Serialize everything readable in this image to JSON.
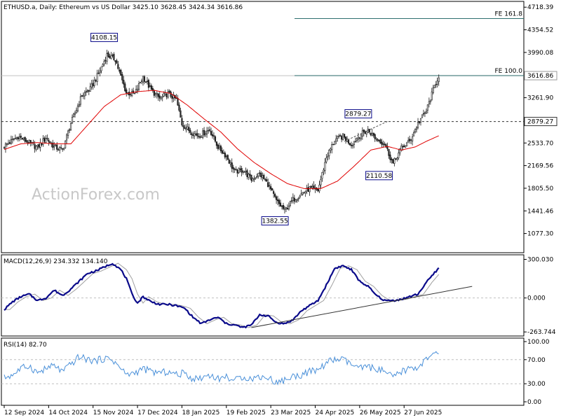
{
  "chart_data": [
    {
      "type": "candlestick",
      "panel": "price",
      "header": "ETHUSD.a, Daily:  Ethereum vs US Dollar  3425.10 3628.45 3424.34 3616.86",
      "ylim": [
        780,
        4800
      ],
      "y_ticks": [
        "4718.39",
        "4354.52",
        "3990.08",
        "3626.06",
        "3261.90",
        "2897.74",
        "2533.70",
        "2169.56",
        "1805.50",
        "1441.46",
        "1077.30"
      ],
      "current_price": "3616.86",
      "current_price_value": 3616.86,
      "level_label": "2879.27",
      "level_value": 2879.27,
      "fib_lines": [
        {
          "label": "FE 161.8",
          "value": 4536
        },
        {
          "label": "FE 100.0",
          "value": 3617
        }
      ],
      "price_labels": [
        {
          "text": "4108.15",
          "value": 4108.15
        },
        {
          "text": "2879.27",
          "value": 2879.27
        },
        {
          "text": "2110.58",
          "value": 2110.58
        },
        {
          "text": "1382.55",
          "value": 1382.55
        }
      ],
      "close_anchors": [
        [
          0,
          2480
        ],
        [
          10,
          2640
        ],
        [
          16,
          2560
        ],
        [
          24,
          2460
        ],
        [
          30,
          2620
        ],
        [
          36,
          2470
        ],
        [
          42,
          2420
        ],
        [
          48,
          2850
        ],
        [
          56,
          3300
        ],
        [
          62,
          3400
        ],
        [
          68,
          3650
        ],
        [
          74,
          3950
        ],
        [
          80,
          3880
        ],
        [
          84,
          3600
        ],
        [
          88,
          3340
        ],
        [
          94,
          3320
        ],
        [
          100,
          3600
        ],
        [
          106,
          3380
        ],
        [
          112,
          3250
        ],
        [
          118,
          3330
        ],
        [
          124,
          3230
        ],
        [
          128,
          2840
        ],
        [
          134,
          2720
        ],
        [
          140,
          2650
        ],
        [
          148,
          2750
        ],
        [
          154,
          2470
        ],
        [
          160,
          2320
        ],
        [
          166,
          2070
        ],
        [
          172,
          2100
        ],
        [
          178,
          1950
        ],
        [
          184,
          2040
        ],
        [
          190,
          1870
        ],
        [
          196,
          1600
        ],
        [
          202,
          1450
        ],
        [
          208,
          1620
        ],
        [
          214,
          1720
        ],
        [
          220,
          1800
        ],
        [
          226,
          1770
        ],
        [
          232,
          2300
        ],
        [
          238,
          2580
        ],
        [
          244,
          2640
        ],
        [
          250,
          2510
        ],
        [
          256,
          2660
        ],
        [
          262,
          2740
        ],
        [
          268,
          2600
        ],
        [
          274,
          2520
        ],
        [
          280,
          2200
        ],
        [
          286,
          2450
        ],
        [
          292,
          2560
        ],
        [
          298,
          2850
        ],
        [
          304,
          3050
        ],
        [
          310,
          3450
        ],
        [
          313,
          3617
        ]
      ],
      "ma_anchors": [
        [
          0,
          2430
        ],
        [
          12,
          2520
        ],
        [
          24,
          2540
        ],
        [
          36,
          2520
        ],
        [
          48,
          2520
        ],
        [
          60,
          2820
        ],
        [
          72,
          3120
        ],
        [
          84,
          3310
        ],
        [
          96,
          3360
        ],
        [
          108,
          3380
        ],
        [
          120,
          3330
        ],
        [
          132,
          3140
        ],
        [
          144,
          2920
        ],
        [
          156,
          2710
        ],
        [
          168,
          2440
        ],
        [
          180,
          2220
        ],
        [
          192,
          2040
        ],
        [
          204,
          1880
        ],
        [
          216,
          1800
        ],
        [
          228,
          1800
        ],
        [
          240,
          1920
        ],
        [
          252,
          2160
        ],
        [
          264,
          2420
        ],
        [
          276,
          2480
        ],
        [
          286,
          2420
        ],
        [
          296,
          2470
        ],
        [
          304,
          2560
        ],
        [
          313,
          2650
        ]
      ],
      "trendline_dashed": [
        [
          245,
          2560
        ],
        [
          276,
          2880
        ]
      ],
      "candle_count": 314
    },
    {
      "type": "line",
      "panel": "macd",
      "title": "MACD(12,26,9) 234.332 134.140",
      "ylim": [
        -290,
        330
      ],
      "y_ticks": [
        "300.030",
        "0.000",
        "-263.744"
      ],
      "macd_anchors": [
        [
          0,
          -90
        ],
        [
          6,
          -30
        ],
        [
          12,
          10
        ],
        [
          18,
          30
        ],
        [
          24,
          -20
        ],
        [
          30,
          0
        ],
        [
          36,
          60
        ],
        [
          42,
          20
        ],
        [
          48,
          70
        ],
        [
          54,
          130
        ],
        [
          60,
          190
        ],
        [
          66,
          210
        ],
        [
          72,
          240
        ],
        [
          78,
          270
        ],
        [
          84,
          220
        ],
        [
          88,
          150
        ],
        [
          92,
          30
        ],
        [
          96,
          -40
        ],
        [
          100,
          10
        ],
        [
          106,
          -30
        ],
        [
          112,
          -50
        ],
        [
          118,
          -50
        ],
        [
          124,
          -60
        ],
        [
          130,
          -80
        ],
        [
          136,
          -150
        ],
        [
          142,
          -200
        ],
        [
          148,
          -170
        ],
        [
          154,
          -150
        ],
        [
          160,
          -200
        ],
        [
          166,
          -210
        ],
        [
          172,
          -230
        ],
        [
          178,
          -210
        ],
        [
          184,
          -130
        ],
        [
          190,
          -140
        ],
        [
          196,
          -190
        ],
        [
          202,
          -200
        ],
        [
          208,
          -170
        ],
        [
          214,
          -100
        ],
        [
          220,
          -60
        ],
        [
          226,
          -20
        ],
        [
          232,
          100
        ],
        [
          238,
          230
        ],
        [
          244,
          250
        ],
        [
          250,
          220
        ],
        [
          256,
          130
        ],
        [
          262,
          90
        ],
        [
          268,
          20
        ],
        [
          274,
          -20
        ],
        [
          280,
          -20
        ],
        [
          286,
          -10
        ],
        [
          292,
          10
        ],
        [
          298,
          30
        ],
        [
          304,
          120
        ],
        [
          313,
          234
        ]
      ],
      "signal_lag": 4,
      "trendline": [
        [
          178,
          -230
        ],
        [
          337,
          90
        ]
      ]
    },
    {
      "type": "line",
      "panel": "rsi",
      "title": "RSI(14) 82.70",
      "ylim": [
        0,
        100
      ],
      "y_ticks": [
        "100.00",
        "70.00",
        "30.00",
        "0.00"
      ],
      "levels": [
        70,
        30
      ],
      "rsi_anchors": [
        [
          0,
          40
        ],
        [
          6,
          45
        ],
        [
          12,
          55
        ],
        [
          18,
          60
        ],
        [
          24,
          48
        ],
        [
          30,
          55
        ],
        [
          36,
          60
        ],
        [
          42,
          50
        ],
        [
          48,
          62
        ],
        [
          54,
          75
        ],
        [
          60,
          70
        ],
        [
          66,
          68
        ],
        [
          72,
          72
        ],
        [
          78,
          70
        ],
        [
          84,
          55
        ],
        [
          88,
          45
        ],
        [
          94,
          48
        ],
        [
          100,
          55
        ],
        [
          106,
          50
        ],
        [
          112,
          48
        ],
        [
          118,
          50
        ],
        [
          124,
          45
        ],
        [
          130,
          48
        ],
        [
          136,
          38
        ],
        [
          142,
          40
        ],
        [
          148,
          45
        ],
        [
          154,
          38
        ],
        [
          160,
          42
        ],
        [
          166,
          35
        ],
        [
          172,
          42
        ],
        [
          178,
          38
        ],
        [
          184,
          42
        ],
        [
          190,
          40
        ],
        [
          196,
          32
        ],
        [
          202,
          36
        ],
        [
          208,
          42
        ],
        [
          214,
          45
        ],
        [
          220,
          50
        ],
        [
          226,
          52
        ],
        [
          232,
          65
        ],
        [
          238,
          70
        ],
        [
          244,
          70
        ],
        [
          250,
          62
        ],
        [
          256,
          55
        ],
        [
          262,
          58
        ],
        [
          268,
          55
        ],
        [
          274,
          50
        ],
        [
          280,
          40
        ],
        [
          286,
          50
        ],
        [
          292,
          55
        ],
        [
          298,
          58
        ],
        [
          304,
          70
        ],
        [
          313,
          82.7
        ]
      ]
    }
  ],
  "x_axis": {
    "labels": [
      {
        "text": "12 Sep 2024",
        "index": 0
      },
      {
        "text": "14 Oct 2024",
        "index": 32
      },
      {
        "text": "15 Nov 2024",
        "index": 64
      },
      {
        "text": "17 Dec 2024",
        "index": 96
      },
      {
        "text": "18 Jan 2025",
        "index": 128
      },
      {
        "text": "19 Feb 2025",
        "index": 160
      },
      {
        "text": "23 Mar 2025",
        "index": 192
      },
      {
        "text": "24 Apr 2025",
        "index": 224
      },
      {
        "text": "26 May 2025",
        "index": 256
      },
      {
        "text": "27 Jun 2025",
        "index": 288
      }
    ]
  },
  "watermark": "ActionForex.com",
  "colors": {
    "bull_candle": "#ffffff",
    "bear_candle": "#2a2a2a",
    "ma_line": "#e00000",
    "macd_line": "#0a0a8a",
    "signal_line": "#a0a0a0",
    "rsi_line": "#4a90d9",
    "fib_line": "#2e6e6e",
    "grid_line": "#c0c0c0"
  }
}
